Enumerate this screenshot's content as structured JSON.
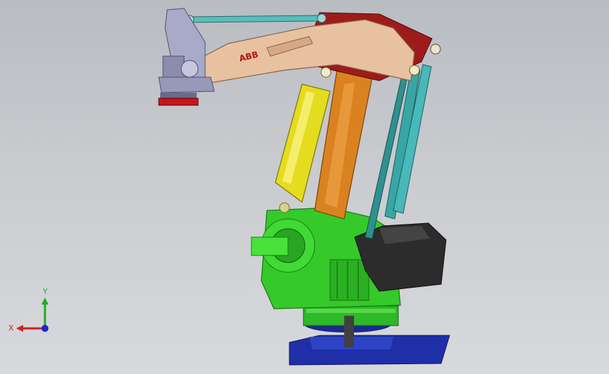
{
  "viewport": {
    "background_top": "#b9bcc1",
    "background_bottom": "#d8d9dc"
  },
  "robot": {
    "brand_label": "ABB",
    "colors": {
      "upper_arm": "#e8c2a0",
      "upper_arm_red": "#9e1b1b",
      "cylinder": "#e4dc1f",
      "lower_arm": "#d9821f",
      "base": "#36c92a",
      "counterweight": "#2c2c2c",
      "tie_rods": "#3aa5a5",
      "foot": "#1e2fa8",
      "wrist": "#a9a9c8",
      "gripper_pad": "#c4161c"
    }
  },
  "triad": {
    "x_label": "X",
    "y_label": "Y",
    "x_color": "#cc2222",
    "y_color": "#22aa22",
    "z_color": "#2222cc"
  }
}
